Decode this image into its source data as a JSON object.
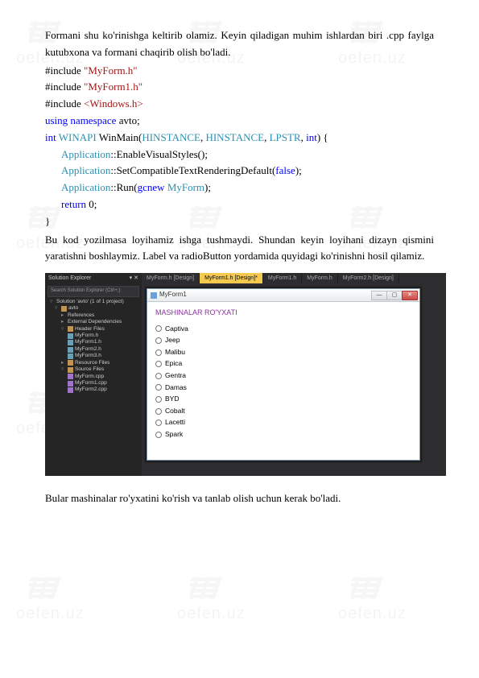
{
  "para1": "Formani shu ko'rinishga keltirib olamiz. Keyin qiladigan muhim ishlardan biri .cpp faylga kutubxona va formani chaqirib olish bo'ladi.",
  "code": {
    "inc1_kw": "#include ",
    "inc1_str": "\"MyForm.h\"",
    "inc2_kw": "#include ",
    "inc2_str": "\"MyForm1.h\"",
    "inc3_kw": "#include ",
    "inc3_str": "<Windows.h>",
    "using_kw": "using namespace",
    "using_ns": " avto;",
    "ret_type": "int ",
    "winapi": "WINAPI",
    "fn_name": " WinMain(",
    "hinst": "HINSTANCE",
    "comma": ", ",
    "lpstr": "LPSTR",
    "int_kw": "int",
    "paren_brace": ") {",
    "app": "Application",
    "dcolon": "::",
    "evs": "EnableVisualStyles();",
    "sctrd_pre": "SetCompatibleTextRenderingDefault(",
    "false_kw": "false",
    "sctrd_post": ");",
    "run_pre": "Run(",
    "gcnew": "gcnew",
    "space": " ",
    "myform": "MyForm",
    "run_post": ");",
    "return_kw": "return",
    "return_val": " 0;",
    "close": "}"
  },
  "para2": "Bu kod yozilmasa loyihamiz ishga tushmaydi. Shundan keyin loyihani dizayn qismini yaratishni boshlaymiz.  Label va radioButton yordamida quyidagi ko'rinishni hosil qilamiz.",
  "ide": {
    "solution_explorer": "Solution Explorer",
    "search_placeholder": "Search Solution Explorer (Ctrl+;)",
    "tabs": [
      {
        "label": "MyForm.h [Design]"
      },
      {
        "label": "MyForm1.h [Design]*"
      },
      {
        "label": "MyForm1.h"
      },
      {
        "label": "MyForm.h"
      },
      {
        "label": "MyForm2.h [Design]"
      }
    ],
    "tree": {
      "solution": "Solution 'avto' (1 of 1 project)",
      "project": "avto",
      "refs": "References",
      "ext": "External Dependencies",
      "headers": "Header Files",
      "h1": "MyForm.h",
      "h2": "MyForm1.h",
      "h3": "MyForm2.h",
      "h4": "MyForm3.h",
      "resources": "Resource Files",
      "sources": "Source Files",
      "s1": "MyForm.cpp",
      "s2": "MyForm1.cpp",
      "s3": "MyForm2.cpp"
    },
    "form": {
      "title": "MyForm1",
      "heading": "MASHINALAR RO'YXATI",
      "radios": [
        "Captiva",
        "Jeep",
        "Malibu",
        "Epica",
        "Gentra",
        "Damas",
        "BYD",
        "Cobalt",
        "Lacetti",
        "Spark"
      ]
    }
  },
  "para3": "Bular mashinalar ro'yxatini ko'rish va tanlab olish uchun kerak bo'ladi.",
  "watermark": "oefen.uz"
}
